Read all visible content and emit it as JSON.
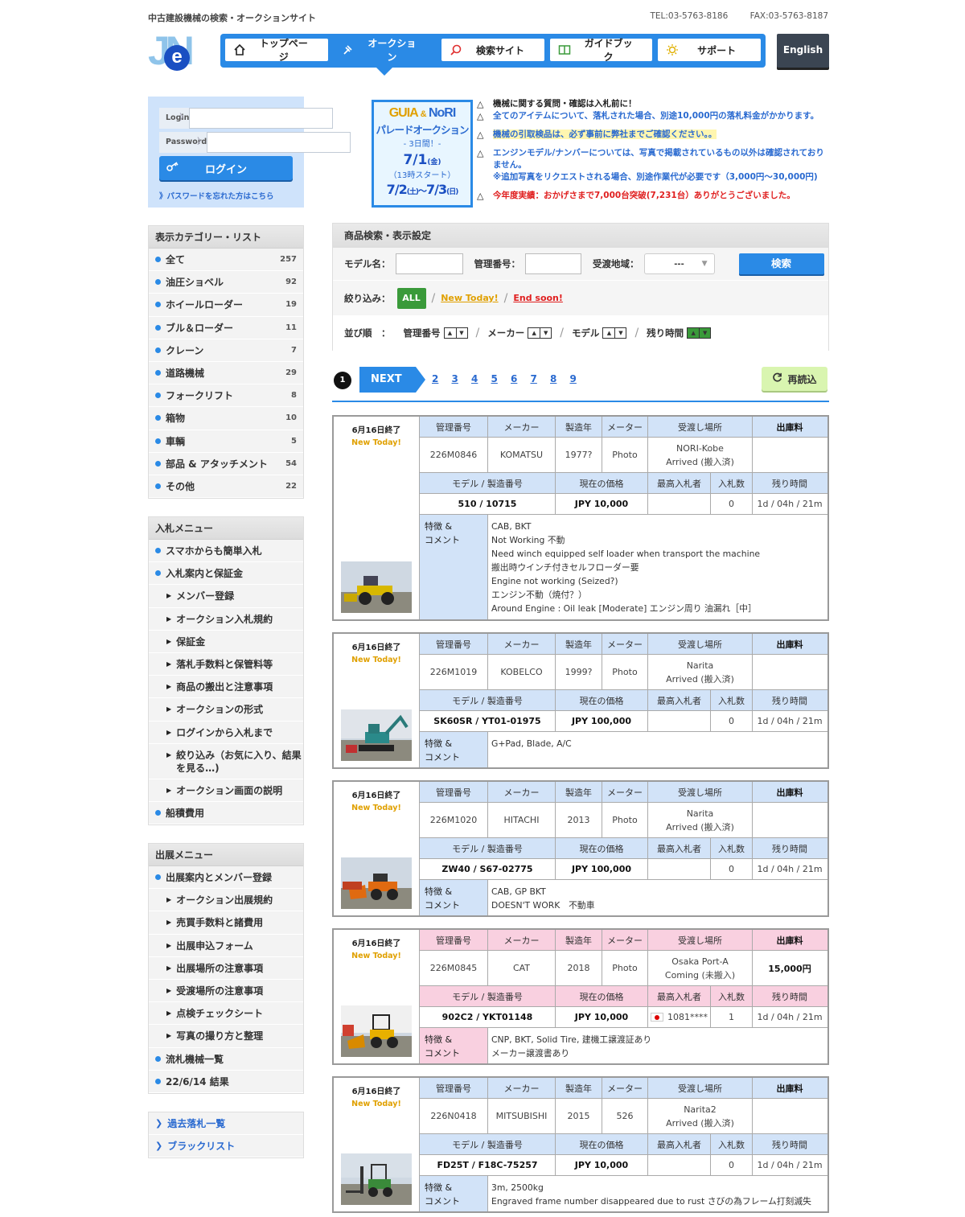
{
  "header": {
    "tagline": "中古建設機械の検索・オークションサイト",
    "tel": "TEL:03-5763-8186",
    "fax": "FAX:03-5763-8187",
    "logo_text": "JN",
    "logo_e": "e",
    "english_label": "English"
  },
  "nav": {
    "items": [
      {
        "label": "トップページ",
        "icon": "home-icon"
      },
      {
        "label": "オークション",
        "icon": "gavel-icon",
        "active": true
      },
      {
        "label": "検索サイト",
        "icon": "search-icon"
      },
      {
        "label": "ガイドブック",
        "icon": "book-icon"
      },
      {
        "label": "サポート",
        "icon": "sun-icon"
      }
    ]
  },
  "login": {
    "id_label": "Login ID",
    "pw_label": "Password",
    "button": "ログイン",
    "forgot": "》パスワードを忘れた方はこちら"
  },
  "categories": {
    "title": "表示カテゴリー・リスト",
    "items": [
      {
        "label": "全て",
        "count": "257"
      },
      {
        "label": "油圧ショベル",
        "count": "92"
      },
      {
        "label": "ホイールローダー",
        "count": "19"
      },
      {
        "label": "ブル＆ローダー",
        "count": "11"
      },
      {
        "label": "クレーン",
        "count": "7"
      },
      {
        "label": "道路機械",
        "count": "29"
      },
      {
        "label": "フォークリフト",
        "count": "8"
      },
      {
        "label": "箱物",
        "count": "10"
      },
      {
        "label": "車輌",
        "count": "5"
      },
      {
        "label": "部品 & アタッチメント",
        "count": "54"
      },
      {
        "label": "その他",
        "count": "22"
      }
    ]
  },
  "bid_menu": {
    "title": "入札メニュー",
    "items": [
      "スマホからも簡単入札",
      "入札案内と保証金",
      "メンバー登録",
      "オークション入札規約",
      "保証金",
      "落札手数料と保管料等",
      "商品の搬出と注意事項",
      "オークションの形式",
      "ログインから入札まで",
      "絞り込み（お気に入り、結果を見る…)",
      "オークション画面の説明",
      "船積費用"
    ]
  },
  "seller_menu": {
    "title": "出展メニュー",
    "items": [
      "出展案内とメンバー登録",
      "オークション出展規約",
      "売買手数料と諸費用",
      "出展申込フォーム",
      "出展場所の注意事項",
      "受渡場所の注意事項",
      "点検チェックシート",
      "写真の撮り方と整理",
      "流札機械一覧",
      "22/6/14 結果"
    ]
  },
  "extra_links": [
    "過去落札一覧",
    "ブラックリスト"
  ],
  "banner": {
    "l1a": "GUIA",
    "amp": "&",
    "l1b": "NoRI",
    "l2": "パレードオークション",
    "l3": "- 3日間！-",
    "l4": "7/1",
    "l4d": "(金)",
    "l5": "（13時スタート）",
    "l6a": "7/2",
    "l6ad": "(土)",
    "l6s": "～",
    "l6b": "7/3",
    "l6bd": "(日)"
  },
  "notices": [
    {
      "text": "機械に関する質問・確認は入札前に！",
      "style": "black"
    },
    {
      "text": "全てのアイテムについて、落札された場合、別途10,000円の落札料金がかかります。",
      "style": "blue"
    },
    {
      "text": "機械の引取検品は、必ず事前に弊社までご確認ください。。",
      "style": "hl"
    },
    {
      "text": "エンジンモデル/ナンバーについては、写真で掲載されているもの以外は確認されておりません。",
      "text2": "※追加写真をリクエストされる場合、別途作業代が必要です（3,000円〜30,000円)",
      "style": "blue"
    },
    {
      "text": "今年度実績：おかげさまで7,000台突破(7,231台）ありがとうございました。",
      "style": "red"
    }
  ],
  "search": {
    "title": "商品検索・表示設定",
    "model_label": "モデル名：",
    "mgmt_label": "管理番号：",
    "region_label": "受渡地域：",
    "region_value": "---",
    "search_button": "検索",
    "filter_label": "絞り込み：",
    "filter_all": "ALL",
    "filter_new": "New Today!",
    "filter_end": "End soon!",
    "sort_label": "並び順　：",
    "sort_keys": [
      "管理番号",
      "メーカー",
      "モデル",
      "残り時間"
    ]
  },
  "pager": {
    "current": "1",
    "next": "NEXT",
    "pages": [
      "2",
      "3",
      "4",
      "5",
      "6",
      "7",
      "8",
      "9"
    ],
    "reload": "再読込"
  },
  "columns": {
    "mgmt": "管理番号",
    "maker": "メーカー",
    "year": "製造年",
    "meter": "メーター",
    "place": "受渡し場所",
    "fee": "出庫料",
    "model": "モデル / 製造番号",
    "price": "現在の価格",
    "bidder": "最高入札者",
    "bids": "入札数",
    "time": "残り時間",
    "comment1": "特徴 &",
    "comment2": "コメント"
  },
  "listings": [
    {
      "end": "6月16日終了",
      "new": "New Today!",
      "mgmt": "226M0846",
      "maker": "KOMATSU",
      "year": "1977?",
      "meter": "Photo",
      "place1": "NORI-Kobe",
      "place2": "Arrived (搬入済)",
      "fee": "",
      "model": "510 / 10715",
      "price": "JPY 10,000",
      "bidder": "",
      "bids": "0",
      "time": "1d / 04h / 21m",
      "comments": [
        "CAB, BKT",
        "Not Working 不動",
        "Need winch equipped self loader when transport the machine",
        "搬出時ウインチ付きセルフローダー要",
        "Engine not working (Seized?)",
        "エンジン不動（焼付？）",
        "Around Engine : Oil leak [Moderate] エンジン周り 油漏れ［中］"
      ],
      "photo": "wheel-loader"
    },
    {
      "end": "6月16日終了",
      "new": "New Today!",
      "mgmt": "226M1019",
      "maker": "KOBELCO",
      "year": "1999?",
      "meter": "Photo",
      "place1": "Narita",
      "place2": "Arrived (搬入済)",
      "fee": "",
      "model": "SK60SR / YT01-01975",
      "price": "JPY 100,000",
      "bidder": "",
      "bids": "0",
      "time": "1d / 04h / 21m",
      "comments": [
        "G+Pad, Blade, A/C"
      ],
      "photo": "excavator"
    },
    {
      "end": "6月16日終了",
      "new": "New Today!",
      "mgmt": "226M1020",
      "maker": "HITACHI",
      "year": "2013",
      "meter": "Photo",
      "place1": "Narita",
      "place2": "Arrived (搬入済)",
      "fee": "",
      "model": "ZW40 / S67-02775",
      "price": "JPY 100,000",
      "bidder": "",
      "bids": "0",
      "time": "1d / 04h / 21m",
      "comments": [
        "CAB, GP BKT",
        "DOESN'T WORK　不動車"
      ],
      "photo": "orange-loader"
    },
    {
      "end": "6月16日終了",
      "new": "New Today!",
      "mgmt": "226M0845",
      "maker": "CAT",
      "year": "2018",
      "meter": "Photo",
      "place1": "Osaka Port-A",
      "place2": "Coming (未搬入)",
      "fee": "15,000円",
      "model": "902C2 / YKT01148",
      "price": "JPY 10,000",
      "bidder": "1081****",
      "bids": "1",
      "time": "1d / 04h / 21m",
      "comments": [
        "CNP, BKT, Solid Tire, 建機工譲渡証あり",
        "メーカー譲渡書あり"
      ],
      "photo": "cat-loader"
    },
    {
      "end": "6月16日終了",
      "new": "New Today!",
      "mgmt": "226N0418",
      "maker": "MITSUBISHI",
      "year": "2015",
      "meter": "526",
      "place1": "Narita2",
      "place2": "Arrived (搬入済)",
      "fee": "",
      "model": "FD25T / F18C-75257",
      "price": "JPY 10,000",
      "bidder": "",
      "bids": "0",
      "time": "1d / 04h / 21m",
      "comments": [
        "3m, 2500kg",
        "Engraved frame number disappeared due to rust さびの為フレーム打刻滅失"
      ],
      "photo": "forklift"
    }
  ]
}
